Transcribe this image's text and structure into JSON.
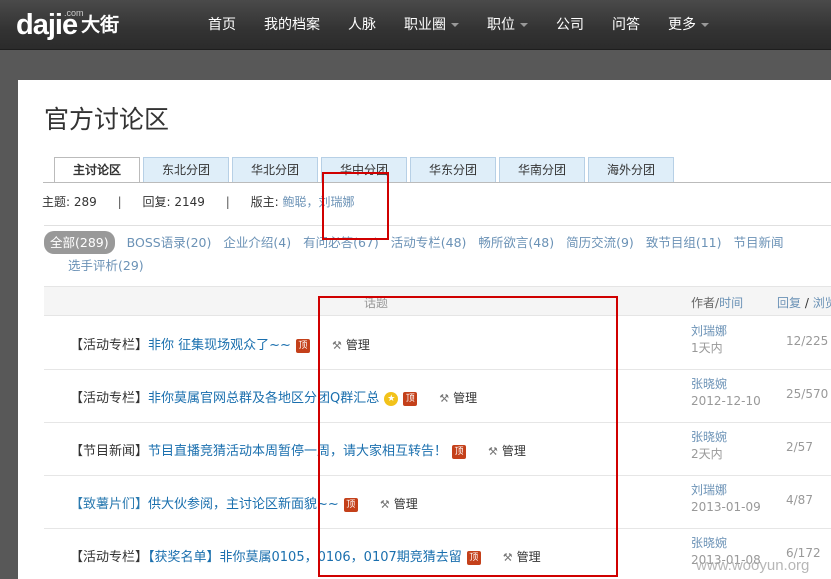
{
  "header": {
    "logo_text": "dajie",
    "logo_com": ".com",
    "logo_cn": "大街",
    "nav": [
      {
        "label": "首页",
        "dropdown": false
      },
      {
        "label": "我的档案",
        "dropdown": false
      },
      {
        "label": "人脉",
        "dropdown": false
      },
      {
        "label": "职业圈",
        "dropdown": true
      },
      {
        "label": "职位",
        "dropdown": true
      },
      {
        "label": "公司",
        "dropdown": false
      },
      {
        "label": "问答",
        "dropdown": false
      },
      {
        "label": "更多",
        "dropdown": true
      }
    ]
  },
  "page": {
    "title": "官方讨论区",
    "tabs": [
      "主讨论区",
      "东北分团",
      "华北分团",
      "华中分团",
      "华东分团",
      "华南分团",
      "海外分团"
    ],
    "active_tab": 0,
    "stats": {
      "topics_label": "主题:",
      "topics_value": "289",
      "replies_label": "回复:",
      "replies_value": "2149",
      "moderator_label": "版主:",
      "moderators": "鲍聪，刘瑞娜"
    },
    "categories": [
      "全部(289)",
      "BOSS语录(20)",
      "企业介绍(4)",
      "有问必答(67)",
      "活动专栏(48)",
      "畅所欲言(48)",
      "简历交流(9)",
      "致节目组(11)",
      "节目新闻",
      "选手评析(29)"
    ],
    "table_header": {
      "topic": "话题",
      "author": "作者",
      "time": "时间",
      "reply": "回复",
      "view": "浏览"
    },
    "rows": [
      {
        "tag": "【活动专栏】",
        "title": "非你  征集现场观众了~~",
        "pinned": true,
        "star": false,
        "manage": "管理",
        "author": "刘瑞娜",
        "time": "1天内",
        "counts": "12/225",
        "tag_blue": false
      },
      {
        "tag": "【活动专栏】",
        "title": "非你莫属官网总群及各地区分团Q群汇总",
        "pinned": true,
        "star": true,
        "manage": "管理",
        "author": "张晓婉",
        "time": "2012-12-10",
        "counts": "25/570",
        "tag_blue": false
      },
      {
        "tag": "【节目新闻】",
        "title": "节目直播竞猜活动本周暂停一周，请大家相互转告！",
        "pinned": true,
        "star": false,
        "manage": "管理",
        "author": "张晓婉",
        "time": "2天内",
        "counts": "2/57",
        "tag_blue": false
      },
      {
        "tag": "【致薯片们】",
        "title": "供大伙参阅，主讨论区新面貌~~",
        "pinned": true,
        "star": false,
        "manage": "管理",
        "author": "刘瑞娜",
        "time": "2013-01-09",
        "counts": "4/87",
        "tag_blue": true
      },
      {
        "tag": "【活动专栏】",
        "title": "【获奖名单】非你莫属0105，0106，0107期竞猜去留",
        "pinned": true,
        "star": false,
        "manage": "管理",
        "author": "张晓婉",
        "time": "2013-01-08",
        "counts": "6/172",
        "tag_blue": false
      }
    ],
    "badge_char": "顶",
    "star_char": "★"
  },
  "colors": {
    "annotation_red": "#d00000",
    "link_blue": "#1a6fae",
    "pinned_badge": "#c4401a"
  },
  "watermark": "www.wooyun.org"
}
